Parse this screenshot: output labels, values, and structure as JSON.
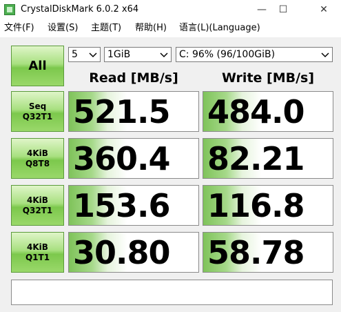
{
  "window": {
    "title": "CrystalDiskMark 6.0.2 x64",
    "minimize": "—",
    "maximize": "☐",
    "close": "✕"
  },
  "menu": [
    {
      "label": "文件(F)"
    },
    {
      "label": "设置(S)"
    },
    {
      "label": "主题(T)"
    },
    {
      "label": "帮助(H)"
    },
    {
      "label": "语言(L)(Language)"
    }
  ],
  "controls": {
    "all_button": "All",
    "count": "5",
    "size": "1GiB",
    "drive": "C: 96% (96/100GiB)"
  },
  "headers": {
    "read": "Read [MB/s]",
    "write": "Write [MB/s]"
  },
  "tests": [
    {
      "label_line1": "Seq",
      "label_line2": "Q32T1",
      "read": "521.5",
      "write": "484.0"
    },
    {
      "label_line1": "4KiB",
      "label_line2": "Q8T8",
      "read": "360.4",
      "write": "82.21"
    },
    {
      "label_line1": "4KiB",
      "label_line2": "Q32T1",
      "read": "153.6",
      "write": "116.8"
    },
    {
      "label_line1": "4KiB",
      "label_line2": "Q1T1",
      "read": "30.80",
      "write": "58.78"
    }
  ],
  "comment": ""
}
